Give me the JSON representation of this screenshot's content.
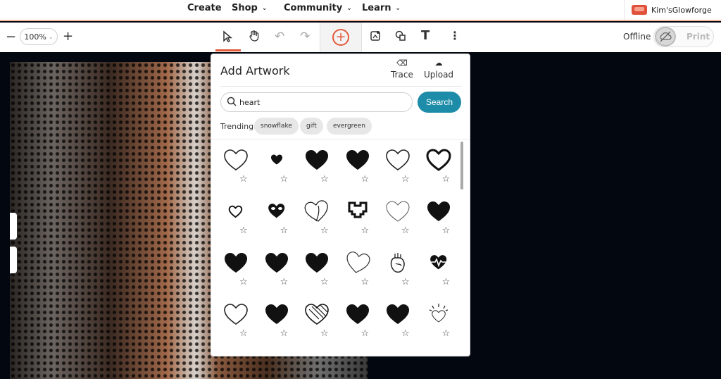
{
  "nav": {
    "items": [
      {
        "label": "Create",
        "chevron": false
      },
      {
        "label": "Shop",
        "chevron": true
      },
      {
        "label": "Community",
        "chevron": true
      },
      {
        "label": "Learn",
        "chevron": true
      }
    ],
    "account": "Kim'sGlowforge"
  },
  "toolbar": {
    "zoom": "100%",
    "status": "Offline",
    "print_label": "Print",
    "icons": [
      "minus-icon",
      "plus-icon",
      "select-arrow-icon",
      "pan-hand-icon",
      "undo-icon",
      "redo-icon",
      "add-artwork-icon",
      "magic-image-icon",
      "shapes-icon",
      "text-icon",
      "more-icon",
      "cloud-offline-icon"
    ]
  },
  "panel": {
    "title": "Add Artwork",
    "trace_label": "Trace",
    "upload_label": "Upload",
    "search_value": "heart",
    "search_button": "Search",
    "trending_label": "Trending:",
    "trending": [
      "snowflake",
      "gift",
      "evergreen"
    ]
  },
  "artwork": [
    "heart-outline-icon",
    "heart-small-solid-icon",
    "heart-solid-icon",
    "heart-solid-icon",
    "heart-outline-icon",
    "heart-bold-outline-icon",
    "heart-outline-small-icon",
    "heart-eyes-icon",
    "heart-sketch-icon",
    "heart-pixel-icon",
    "heart-outline-thin-icon",
    "heart-solid-icon",
    "heart-solid-icon",
    "heart-solid-icon",
    "heart-solid-icon",
    "heart-doodle-icon",
    "anatomical-heart-icon",
    "heart-pulse-icon",
    "heart-outline-icon",
    "heart-solid-icon",
    "heart-hatched-icon",
    "heart-solid-icon",
    "heart-solid-icon",
    "heart-sparkle-icon"
  ],
  "colors": {
    "accent": "#e35a3b",
    "search_button": "#1d8ca8",
    "canvas": "#030810"
  }
}
